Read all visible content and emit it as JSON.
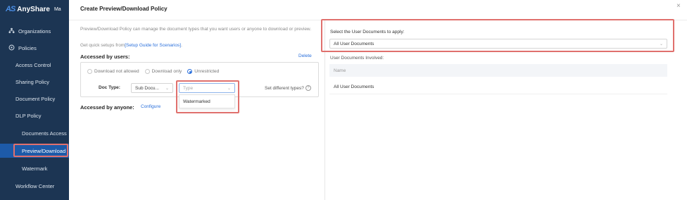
{
  "app": {
    "logo_mark": "AS",
    "logo_text": "AnyShare",
    "logo_extra": "Ma"
  },
  "sidebar": {
    "items": [
      {
        "label": "Organizations",
        "icon": "org-icon"
      },
      {
        "label": "Policies",
        "icon": "policy-icon"
      },
      {
        "label": "Access Control"
      },
      {
        "label": "Sharing Policy"
      },
      {
        "label": "Document Policy"
      },
      {
        "label": "DLP Policy"
      },
      {
        "label": "Documents Access"
      },
      {
        "label": "Preview/Download"
      },
      {
        "label": "Watermark"
      },
      {
        "label": "Workflow Center"
      }
    ]
  },
  "modal": {
    "title": "Create Preview/Download Policy",
    "close": "×",
    "description": "Preview/Download Policy can manage the document types that you want users or anyone to download or preview.",
    "quick_setup_prefix": "Get quick setups from",
    "quick_setup_link": "[Setup Guide for Scenarios]",
    "quick_setup_suffix": ".",
    "accessed_by_users": "Accessed by users:",
    "delete": "Delete",
    "radios": {
      "not_allowed": "Download not allowed",
      "only": "Download only",
      "unrestricted": "Unrestricted"
    },
    "doc_type_label": "Doc Type:",
    "sub_doc_select": "Sub Docu...",
    "type_placeholder": "Type",
    "dropdown_option": "Watermarked",
    "set_different": "Set different types?",
    "accessed_by_anyone": "Accessed by anyone:",
    "configure": "Configure",
    "right": {
      "select_label": "Select the User Documents to apply:",
      "select_value": "All User Documents",
      "involved_label": "User Documents Involved:",
      "table_header": "Name",
      "table_row": "All User Documents"
    }
  },
  "colors": {
    "sidebar_bg": "#1c3553",
    "accent": "#2a6fdb",
    "highlight": "#e0706d"
  }
}
